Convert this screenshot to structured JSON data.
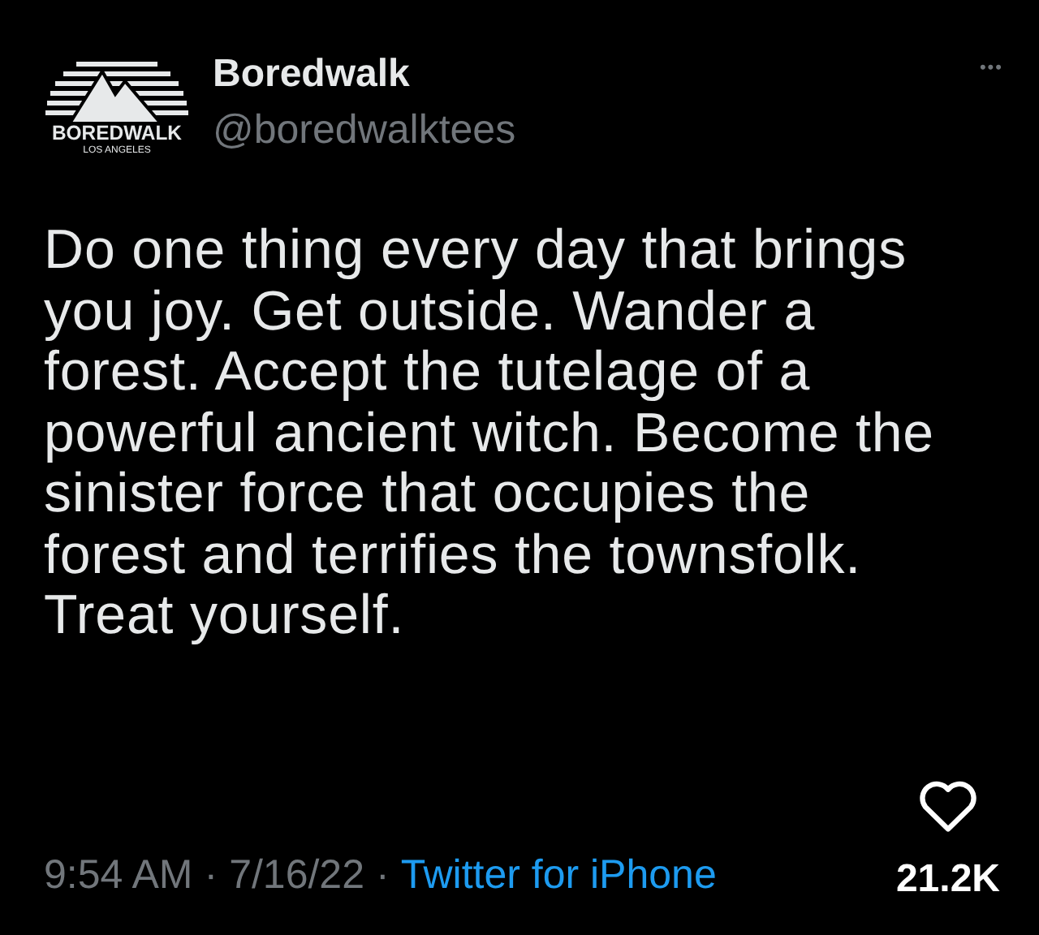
{
  "author": {
    "logo_wordmark": "BOREDWALK",
    "logo_tagline": "LOS ANGELES",
    "name": "Boredwalk",
    "handle": "@boredwalktees"
  },
  "more_menu": "•••",
  "body": "Do one thing every day that brings\nyou joy. Get outside. Wander a\nforest. Accept the tutelage of a\npowerful ancient witch. Become the\nsinister force that occupies the\nforest and terrifies the townsfolk.\nTreat yourself.",
  "footer": {
    "time": "9:54 AM",
    "separator_1": "·",
    "date": "7/16/22",
    "separator_2": "·",
    "source": "Twitter for iPhone"
  },
  "likes": {
    "liked": false,
    "count": "21.2K"
  }
}
